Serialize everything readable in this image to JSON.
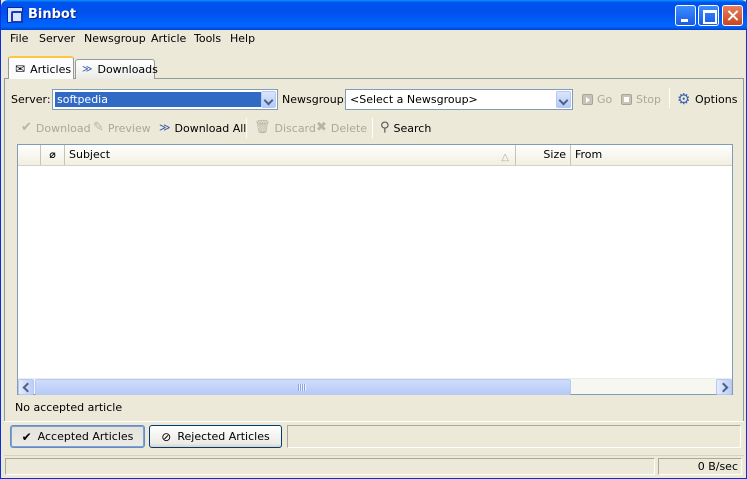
{
  "window": {
    "title": "Binbot"
  },
  "menu": [
    "File",
    "Server",
    "Newsgroup",
    "Article",
    "Tools",
    "Help"
  ],
  "tabs": [
    {
      "label": "Articles",
      "icon": "envelope-icon",
      "active": true
    },
    {
      "label": "Downloads",
      "icon": "double-chevron-down-icon",
      "active": false
    }
  ],
  "server_row": {
    "server_label": "Server:",
    "server_value": "softpedia",
    "newsgroup_label": "Newsgroup:",
    "newsgroup_value": "<Select a Newsgroup>",
    "go_label": "Go",
    "stop_label": "Stop",
    "options_label": "Options"
  },
  "toolbar": {
    "download": "Download",
    "preview": "Preview",
    "download_all": "Download All",
    "discard": "Discard",
    "delete": "Delete",
    "search": "Search"
  },
  "table": {
    "columns": [
      "",
      "",
      "Subject",
      "Size",
      "From"
    ],
    "sort_indicator": "△",
    "rows": []
  },
  "status_message": "No accepted article",
  "bottom_buttons": {
    "accepted": "Accepted Articles",
    "rejected": "Rejected Articles"
  },
  "statusbar": {
    "rate": "0 B/sec"
  },
  "colors": {
    "titlebar": "#0053ee",
    "selection": "#316ac5",
    "window_bg": "#ece9d8"
  }
}
